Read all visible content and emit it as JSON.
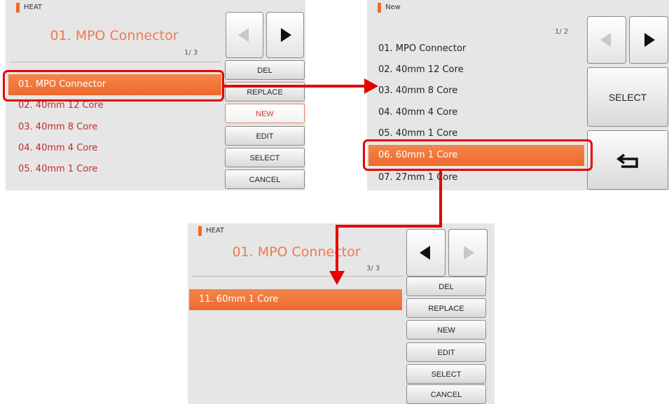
{
  "panel1": {
    "header": "HEAT",
    "title": "01. MPO Connector",
    "page": "1/ 3",
    "items": [
      {
        "label": "01. MPO Connector"
      },
      {
        "label": "02. 40mm 12 Core"
      },
      {
        "label": "03. 40mm 8 Core"
      },
      {
        "label": "04. 40mm 4 Core"
      },
      {
        "label": "05. 40mm 1 Core"
      }
    ],
    "buttons": {
      "del": "DEL",
      "replace": "REPLACE",
      "new": "NEW",
      "edit": "EDIT",
      "select": "SELECT",
      "cancel": "CANCEL"
    }
  },
  "panel2": {
    "header": "New",
    "page": "1/ 2",
    "items": [
      {
        "label": "01. MPO Connector"
      },
      {
        "label": "02. 40mm 12 Core"
      },
      {
        "label": "03. 40mm 8 Core"
      },
      {
        "label": "04. 40mm 4 Core"
      },
      {
        "label": "05. 40mm 1 Core"
      },
      {
        "label": "06. 60mm 1 Core"
      },
      {
        "label": "07. 27mm 1 Core"
      }
    ],
    "buttons": {
      "select": "SELECT"
    }
  },
  "panel3": {
    "header": "HEAT",
    "title": "01. MPO Connector",
    "page": "3/ 3",
    "items": [
      {
        "label": "11. 60mm 1 Core"
      }
    ],
    "buttons": {
      "del": "DEL",
      "replace": "REPLACE",
      "new": "NEW",
      "edit": "EDIT",
      "select": "SELECT",
      "cancel": "CANCEL"
    }
  },
  "colors": {
    "accent": "#f26a2a",
    "selected_row": "#ee6a2e",
    "item_text": "#c82a2a",
    "highlight": "#e60000",
    "panel_bg": "#e6e6e6"
  },
  "icons": [
    "prev-page-icon",
    "next-page-icon",
    "return-icon"
  ]
}
